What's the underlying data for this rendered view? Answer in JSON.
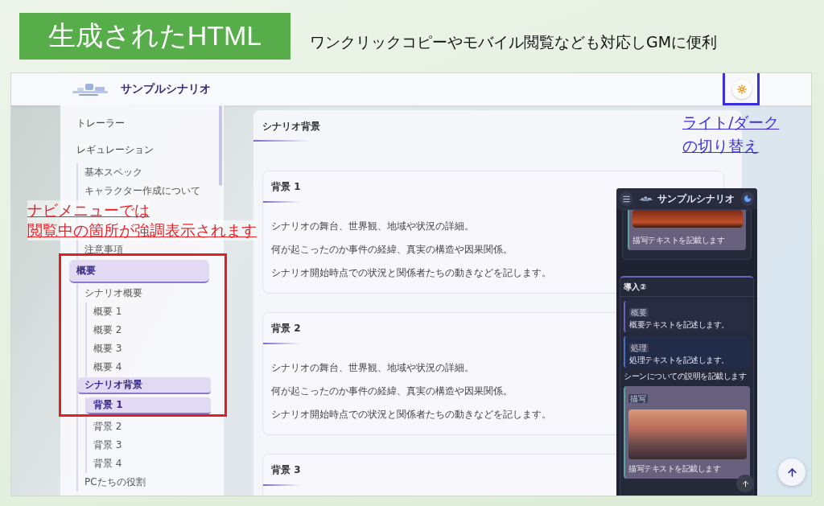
{
  "slide": {
    "title": "生成されたHTML",
    "subtitle": "ワンクリックコピーやモバイル閲覧なども対応しGMに便利"
  },
  "site": {
    "title": "サンプルシナリオ",
    "dark_mode": false
  },
  "theme_callout": {
    "lines": [
      "ライト/ダーク",
      "の切り替え"
    ]
  },
  "nav": [
    {
      "label": "トレーラー",
      "selected": false
    },
    {
      "label": "レギュレーション",
      "selected": false,
      "children": [
        {
          "kind": "link",
          "label": "基本スペック",
          "selected": false
        },
        {
          "kind": "link",
          "label": "キャラクター作成について",
          "selected": false
        },
        {
          "kind": "callout",
          "lines": [
            "ナビメニューでは",
            "閲覧中の箇所が強調表示されます"
          ]
        },
        {
          "kind": "link",
          "label": "注意事項",
          "selected": false
        }
      ]
    },
    {
      "label": "概要",
      "selected": true,
      "children": [
        {
          "kind": "link",
          "label": "シナリオ概要",
          "selected": false,
          "children": [
            {
              "label": "概要 1",
              "selected": false
            },
            {
              "label": "概要 2",
              "selected": false
            },
            {
              "label": "概要 3",
              "selected": false
            },
            {
              "label": "概要 4",
              "selected": false
            }
          ]
        },
        {
          "kind": "link",
          "label": "シナリオ背景",
          "selected": true,
          "children": [
            {
              "label": "背景 1",
              "selected": true
            },
            {
              "label": "背景 2",
              "selected": false
            },
            {
              "label": "背景 3",
              "selected": false
            },
            {
              "label": "背景 4",
              "selected": false
            }
          ]
        },
        {
          "kind": "link",
          "label": "PCたちの役割",
          "selected": false
        }
      ]
    }
  ],
  "content": {
    "title": "シナリオ背景",
    "sections": [
      {
        "title": "背景 1",
        "paragraphs": [
          "シナリオの舞台、世界観、地域や状況の詳細。",
          "何が起こったのか事件の経緯、真実の構造や因果関係。",
          "シナリオ開始時点での状況と関係者たちの動きなどを記します。"
        ]
      },
      {
        "title": "背景 2",
        "paragraphs": [
          "シナリオの舞台、世界観、地域や状況の詳細。",
          "何が起こったのか事件の経緯、真実の構造や因果関係。",
          "シナリオ開始時点での状況と関係者たちの動きなどを記します。"
        ]
      },
      {
        "title": "背景 3"
      }
    ]
  },
  "mobile": {
    "title": "サンプルシナリオ",
    "dark_mode": true,
    "top_card_text": "描写テキストを記載します",
    "section": {
      "title": "導入②",
      "blocks": [
        {
          "kind": "note",
          "tag": "概要",
          "text": "概要テキストを記述します。"
        },
        {
          "kind": "process",
          "tag": "処理",
          "text": "処理テキストを記述します。"
        }
      ],
      "description": "シーンについての説明を記載します",
      "scene": {
        "tag": "描写",
        "text": "描写テキストを記載します"
      }
    }
  }
}
